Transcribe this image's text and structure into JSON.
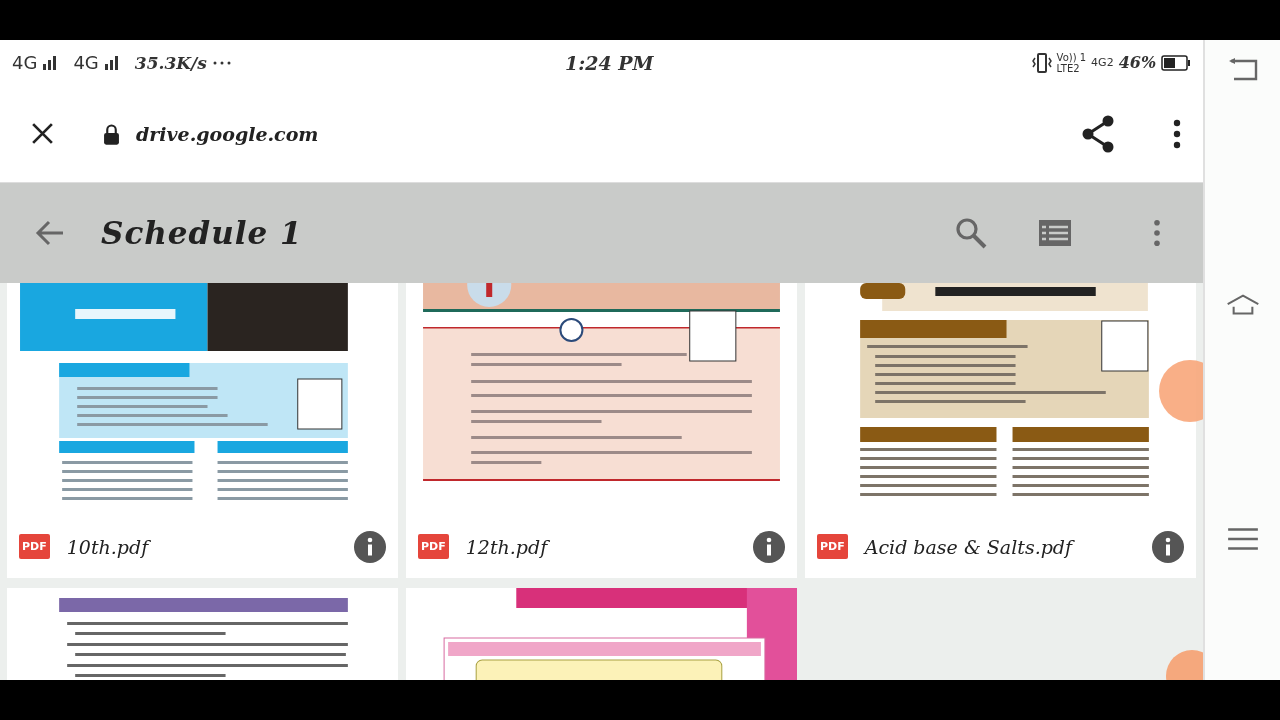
{
  "status_bar": {
    "network_1": "4G",
    "network_2": "4G",
    "speed": "35.3K/s",
    "time": "1:24 PM",
    "volte": "Vo)) 1",
    "lte": "LTE2",
    "network_3": "4G2",
    "battery": "46%"
  },
  "browser_bar": {
    "url": "drive.google.com"
  },
  "app_bar": {
    "title": "Schedule 1"
  },
  "files": [
    {
      "name": "10th.pdf",
      "badge": "PDF",
      "kind": "blue"
    },
    {
      "name": "12th.pdf",
      "badge": "PDF",
      "kind": "peach"
    },
    {
      "name": "Acid base & Salts.pdf",
      "badge": "PDF",
      "kind": "brown"
    },
    {
      "kind": "purple"
    },
    {
      "kind": "pink"
    }
  ]
}
